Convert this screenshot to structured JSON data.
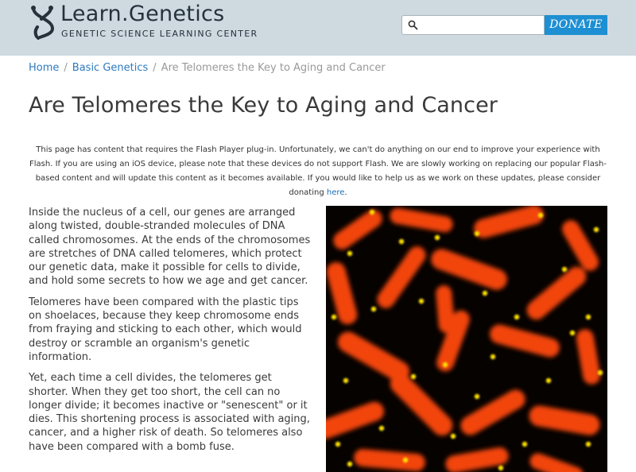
{
  "header": {
    "brand": "Learn.Genetics",
    "tagline": "GENETIC SCIENCE LEARNING CENTER",
    "search_placeholder": "",
    "donate_label": "DONATE",
    "logo_icon": "dna-helix-icon",
    "search_icon": "search-icon"
  },
  "breadcrumb": {
    "home": "Home",
    "section": "Basic Genetics",
    "current": "Are Telomeres the Key to Aging and Cancer",
    "separator": "/"
  },
  "page_title": "Are Telomeres the Key to Aging and Cancer",
  "notice": {
    "text": "This page has content that requires the Flash Player plug-in. Unfortunately, we can't do anything on our end to improve your experience with Flash. If you are using an iOS device, please note that these devices do not support Flash. We are slowly working on replacing our popular Flash-based content and will update this content as it becomes available. If you would like to help us as we work on these updates, please consider donating ",
    "link": "here",
    "end": "."
  },
  "paragraphs": [
    "Inside the nucleus of a cell, our genes are arranged along twisted, double-stranded molecules of DNA called chromosomes. At the ends of the chromosomes are stretches of DNA called telomeres, which protect our genetic data, make it possible for cells to divide, and hold some secrets to how we age and get cancer.",
    "Telomeres have been compared with the plastic tips on shoelaces, because they keep chromosome ends from fraying and sticking to each other, which would destroy or scramble an organism's genetic information.",
    "Yet, each time a cell divides, the telomeres get shorter. When they get too short, the cell can no longer divide; it becomes inactive or \"senescent\" or it dies. This shortening process is associated with aging, cancer, and a higher risk of death. So telomeres also have been compared with a bomb fuse."
  ],
  "colors": {
    "header_bg": "#ced9e0",
    "donate_bg": "#1d8fd2",
    "link": "#2c7ac0",
    "chromosome": "#ff4a10",
    "telomere": "#ffe000"
  }
}
